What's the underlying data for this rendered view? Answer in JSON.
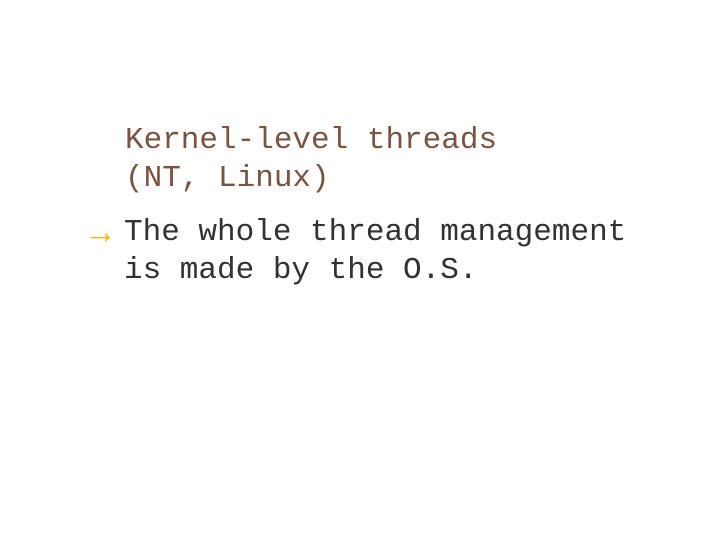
{
  "slide": {
    "title_line1": "Kernel-level threads",
    "title_line2": "(NT, Linux)",
    "bullets": [
      {
        "icon": "→",
        "text": "The whole thread management is made by the O.S."
      }
    ]
  }
}
